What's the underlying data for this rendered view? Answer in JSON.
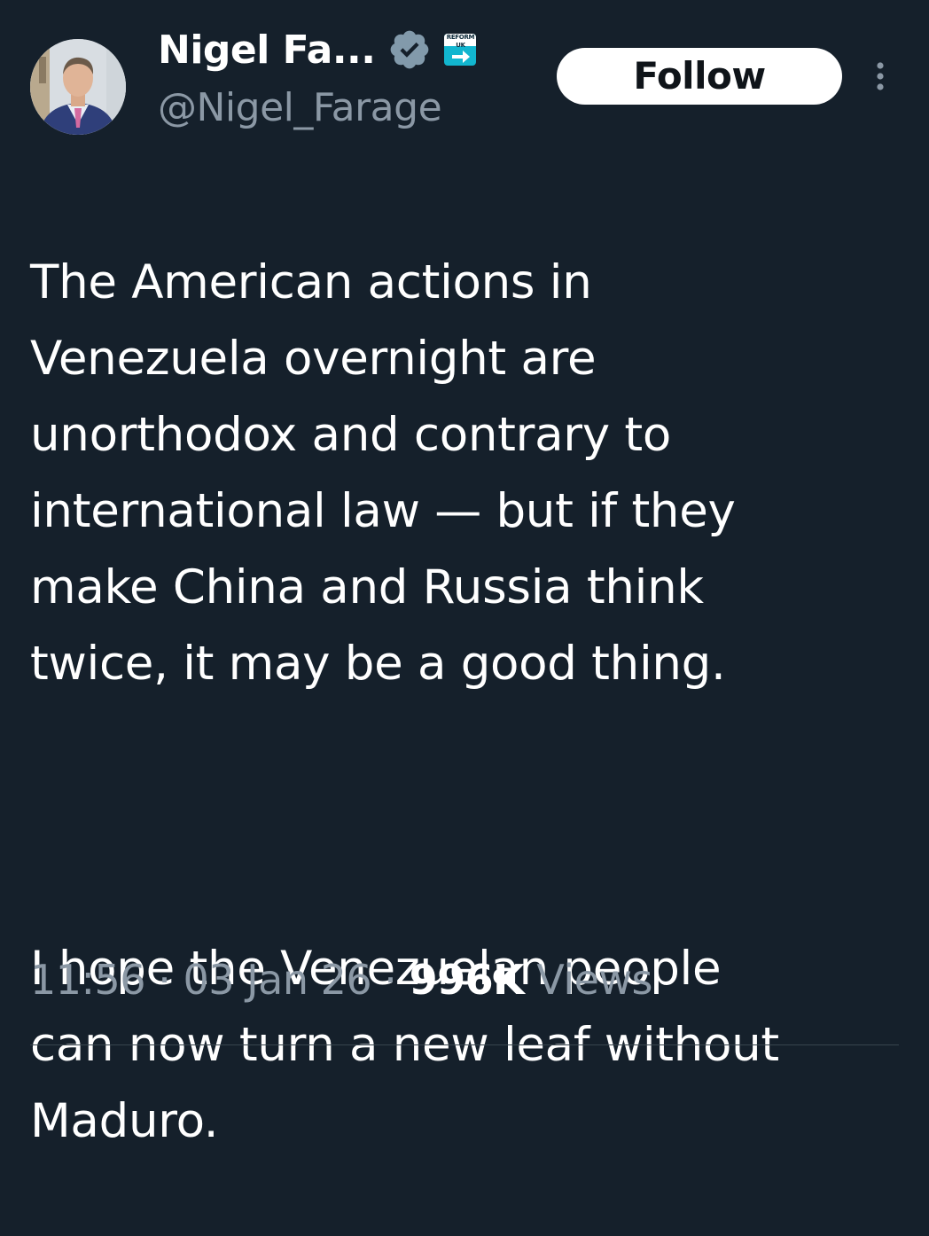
{
  "author": {
    "display_name": "Nigel Fa...",
    "handle": "@Nigel_Farage",
    "affiliate_badge_text": "REFORM UK"
  },
  "actions": {
    "follow_label": "Follow"
  },
  "tweet": {
    "paragraph_1": "The American actions in\nVenezuela overnight are\nunorthodox and contrary to\ninternational law — but if they\nmake China and Russia think\ntwice, it may be a good thing.",
    "paragraph_2": "I hope the Venezuelan people\ncan now turn a new leaf without\nMaduro."
  },
  "meta": {
    "time": "11:56",
    "separator": " · ",
    "date": "03 Jan 26",
    "views_count": "996K",
    "views_label": "Views"
  },
  "colors": {
    "background": "#15202b",
    "text_primary": "#ffffff",
    "text_secondary": "#8b98a5",
    "follow_bg": "#ffffff",
    "verified_grey": "#829aab",
    "affiliate_teal": "#12b6cf"
  },
  "icons": {
    "verified": "verified-badge-icon",
    "more": "more-vertical-icon"
  }
}
